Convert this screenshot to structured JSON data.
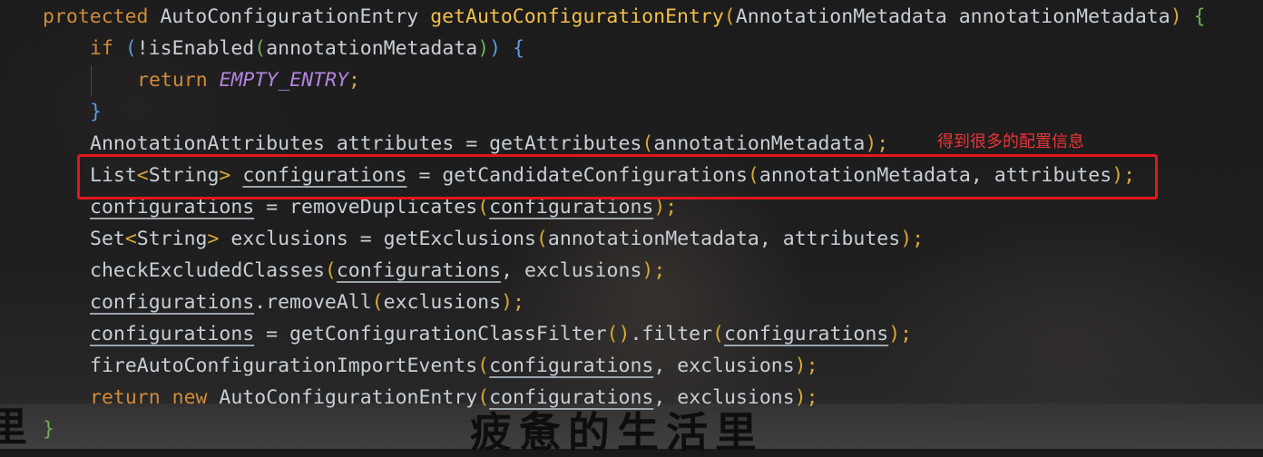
{
  "code": {
    "method_signature": {
      "modifier": "protected",
      "return_type": "AutoConfigurationEntry",
      "name": "getAutoConfigurationEntry",
      "open_paren": "(",
      "param_type": "AnnotationMetadata",
      "param_name": "annotationMetadata",
      "close_paren": ")",
      "open_brace": "{"
    },
    "if_line": {
      "keyword": "if",
      "open1": "(",
      "negated_call": "!isEnabled",
      "open2": "(",
      "arg": "annotationMetadata",
      "close2": ")",
      "close1": ")",
      "brace": "{"
    },
    "return_empty": {
      "keyword": "return",
      "constant": "EMPTY_ENTRY",
      "semicolon": ";"
    },
    "close_if": "}",
    "attributes_line": {
      "prefix": "AnnotationAttributes attributes = getAttributes",
      "open": "(",
      "arg": "annotationMetadata",
      "close": ")",
      "semicolon": ";"
    },
    "configurations_decl": {
      "type": "List",
      "lt": "<",
      "generic": "String",
      "gt": ">",
      "var": "configurations",
      "assign": " = getCandidateConfigurations",
      "open": "(",
      "args": "annotationMetadata, attributes",
      "close": ")",
      "semicolon": ";"
    },
    "remove_duplicates": {
      "var": "configurations",
      "assign": " = removeDuplicates",
      "open": "(",
      "arg": "configurations",
      "close": ")",
      "semicolon": ";"
    },
    "exclusions_decl": {
      "type": "Set",
      "lt": "<",
      "generic": "String",
      "gt": ">",
      "assign": " exclusions = getExclusions",
      "open": "(",
      "args": "annotationMetadata, attributes",
      "close": ")",
      "semicolon": ";"
    },
    "check_excluded": {
      "call": "checkExcludedClasses",
      "open": "(",
      "arg1": "configurations",
      "rest": ", exclusions",
      "close": ")",
      "semicolon": ";"
    },
    "remove_all": {
      "var": "configurations",
      "call": ".removeAll",
      "open": "(",
      "arg": "exclusions",
      "close": ")",
      "semicolon": ";"
    },
    "filter_line": {
      "var": "configurations",
      "assign": " = getConfigurationClassFilter",
      "parens": "()",
      "call": ".filter",
      "open": "(",
      "arg": "configurations",
      "close": ")",
      "semicolon": ";"
    },
    "fire_events": {
      "call": "fireAutoConfigurationImportEvents",
      "open": "(",
      "arg1": "configurations",
      "rest": ", exclusions",
      "close": ")",
      "semicolon": ";"
    },
    "return_new": {
      "return_kw": "return",
      "new_kw": "new",
      "type": " AutoConfigurationEntry",
      "open": "(",
      "arg1": "configurations",
      "rest": ", exclusions",
      "close": ")",
      "semicolon": ";"
    },
    "close_method": "}"
  },
  "annotation": {
    "note": "得到很多的配置信息",
    "highlight_color": "#e4161d"
  },
  "watermark": {
    "left_glyph": "里",
    "center_text": "疲惫的生活里"
  },
  "colors": {
    "keyword": "#d08a3a",
    "method": "#f2bf48",
    "constant": "#b184e0",
    "text": "#c7cfd6",
    "paren_level1": "#d9a834",
    "paren_level2": "#74ae58",
    "paren_level3": "#5c9be0"
  }
}
